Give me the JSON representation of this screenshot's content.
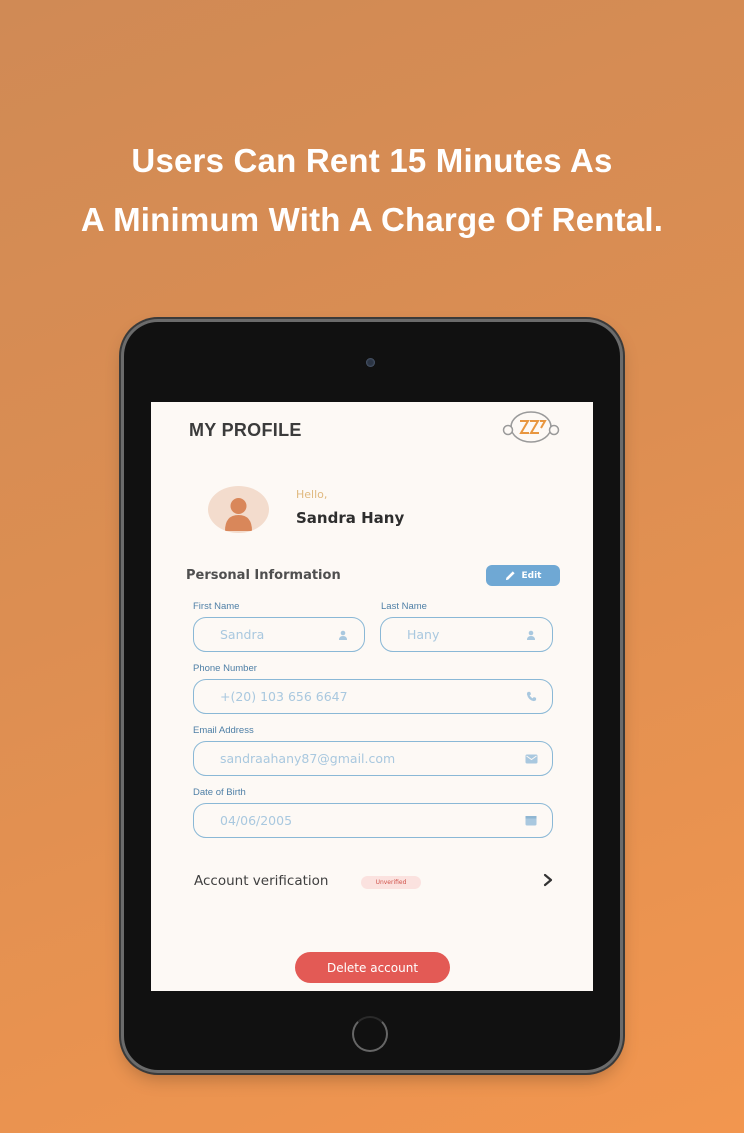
{
  "headline": {
    "line1": "Users Can Rent 15 Minutes As",
    "line2": "A Minimum With A Charge Of Rental."
  },
  "profile": {
    "title": "MY PROFILE",
    "greeting": "Hello,",
    "user_name": "Sandra Hany",
    "section_title": "Personal Information",
    "edit_label": "Edit",
    "fields": {
      "first_name": {
        "label": "First Name",
        "value": "Sandra",
        "icon": "user-icon"
      },
      "last_name": {
        "label": "Last Name",
        "value": "Hany",
        "icon": "user-icon"
      },
      "phone": {
        "label": "Phone Number",
        "value": "+(20) 103 656 6647",
        "icon": "phone-icon"
      },
      "email": {
        "label": "Email Address",
        "value": "sandraahany87@gmail.com",
        "icon": "mail-icon"
      },
      "dob": {
        "label": "Date of Birth",
        "value": "04/06/2005",
        "icon": "calendar-icon"
      }
    },
    "verification": {
      "label": "Account verification",
      "status": "Unverified"
    },
    "delete_label": "Delete account"
  },
  "colors": {
    "background_top": "#d08a55",
    "background_bottom": "#f2964f",
    "edit_button": "#6fa8d4",
    "delete_button": "#e35a55",
    "field_border": "#8ab8d6",
    "greeting": "#e0b97f"
  }
}
